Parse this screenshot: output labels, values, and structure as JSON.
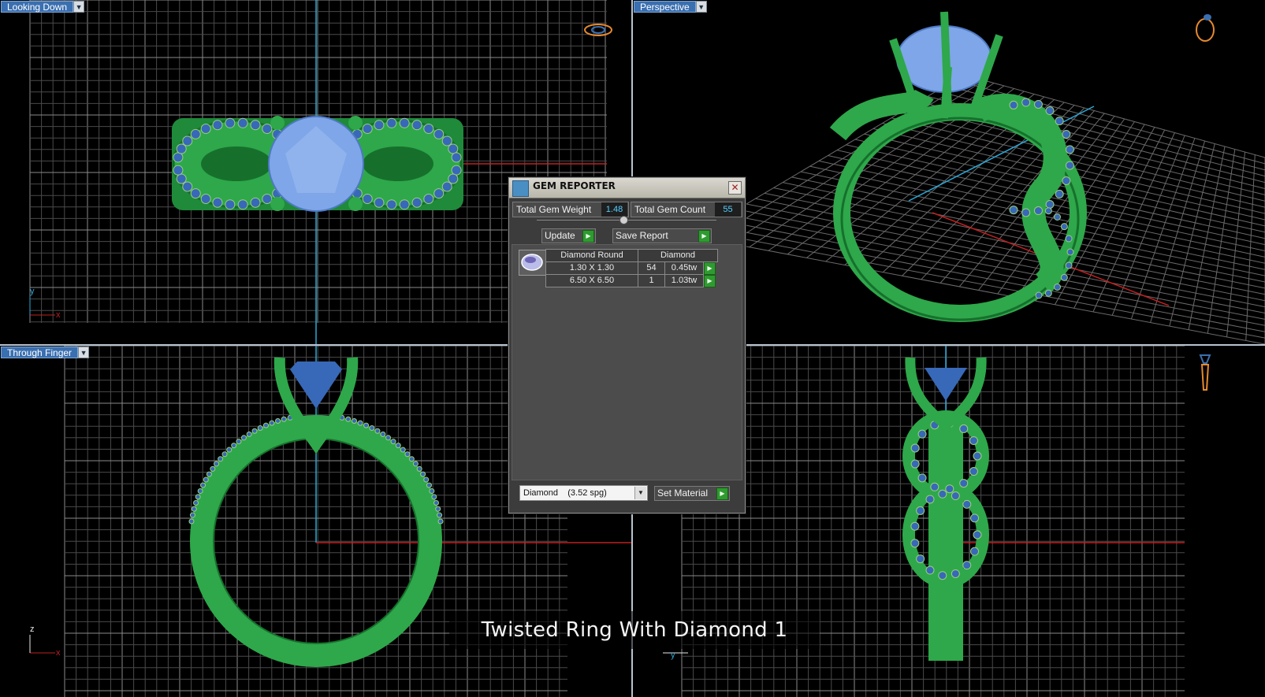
{
  "viewports": {
    "top": {
      "label": "Looking Down",
      "axis_y": "y",
      "axis_x": "x"
    },
    "perspective": {
      "label": "Perspective"
    },
    "front": {
      "label": "Through Finger",
      "axis_z": "z",
      "axis_x": "x"
    },
    "side": {
      "axis_y": "y"
    }
  },
  "colors": {
    "metal": "#2ea84a",
    "metal_dark": "#16702c",
    "gem": "#7fa6e8",
    "small_gem": "#3868b8",
    "grid": "#5c5c5c",
    "axis_blue": "#2aa8d8",
    "axis_red": "#c02020",
    "label_bg": "#3a6fb0"
  },
  "gem_reporter": {
    "title": "GEM REPORTER",
    "total_weight_label": "Total Gem Weight",
    "total_weight_value": "1.48",
    "total_count_label": "Total Gem Count",
    "total_count_value": "55",
    "update_label": "Update",
    "save_report_label": "Save Report",
    "columns": [
      "Diamond Round",
      "Diamond"
    ],
    "rows": [
      {
        "size": "1.30 X 1.30",
        "count": "54",
        "weight": "0.45tw"
      },
      {
        "size": "6.50 X 6.50",
        "count": "1",
        "weight": "1.03tw"
      }
    ],
    "material_value": "Diamond    (3.52 spg)",
    "set_material_label": "Set Material"
  },
  "caption": "Twisted Ring With Diamond 1"
}
